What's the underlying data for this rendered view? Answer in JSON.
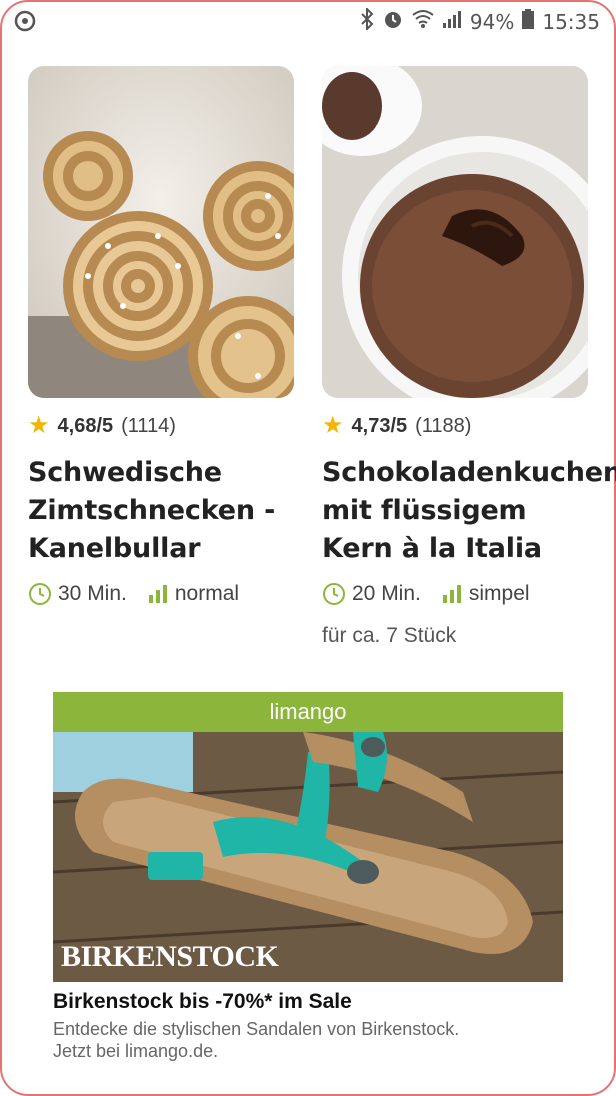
{
  "status_bar": {
    "battery": "94%",
    "time": "15:35",
    "icons": [
      "settings-icon",
      "bluetooth-icon",
      "alarm-icon",
      "wifi-icon",
      "signal-icon",
      "battery-icon"
    ]
  },
  "recipes": [
    {
      "rating": "4,68/5",
      "count": "(1114)",
      "title": "Schwedische Zimtschnecken - Kanelbullar",
      "time": "30 Min.",
      "difficulty": "normal",
      "note": ""
    },
    {
      "rating": "4,73/5",
      "count": "(1188)",
      "title": "Schokoladenkuchen mit flüssigem Kern à la Italia",
      "time": "20 Min.",
      "difficulty": "simpel",
      "note": "für ca. 7 Stück"
    }
  ],
  "ad": {
    "brand": "limango",
    "logo_text": "BIRKENSTOCK",
    "headline": "Birkenstock bis -70%* im Sale",
    "body": "Entdecke die stylischen Sandalen von Birkenstock. Jetzt bei limango.de."
  },
  "colors": {
    "accent_green": "#8cb53b",
    "star": "#f4b400",
    "frame": "#e57373"
  }
}
